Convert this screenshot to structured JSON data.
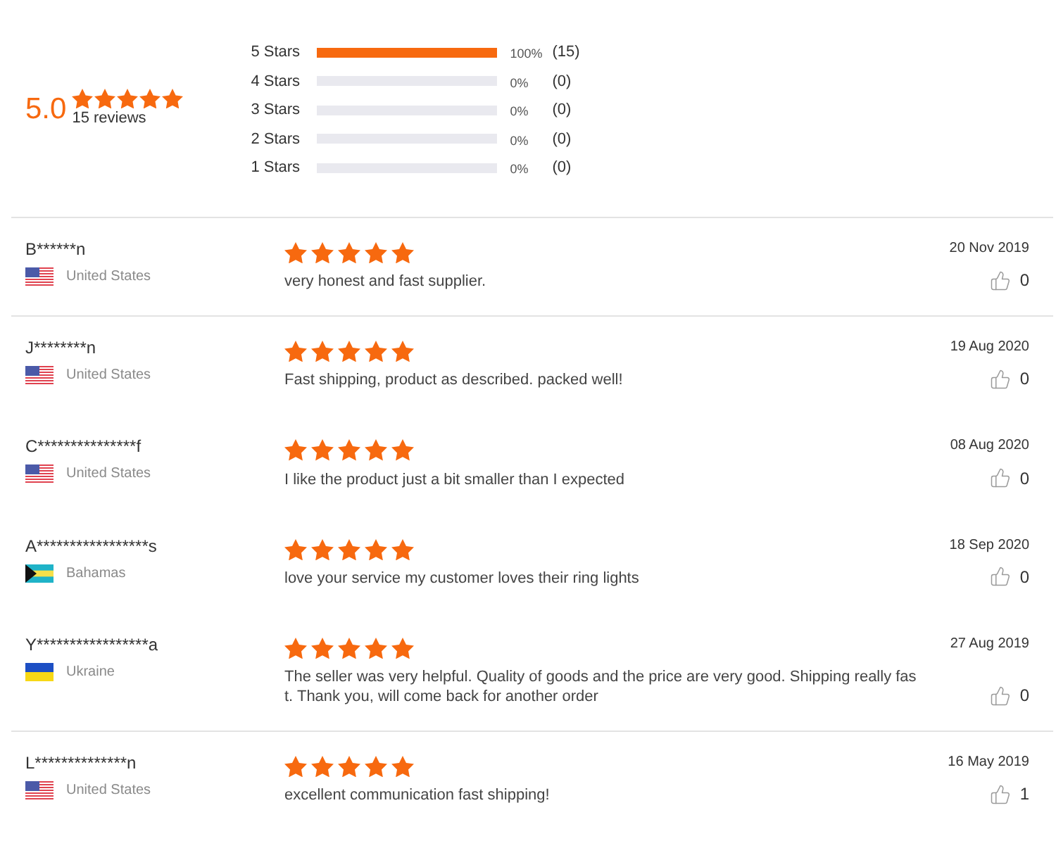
{
  "summary": {
    "rating": "5.0",
    "stars": 5,
    "review_count": "15 reviews"
  },
  "histogram": [
    {
      "label": "5 Stars",
      "level": 1,
      "percent": "100%",
      "count": "(15)"
    },
    {
      "label": "4 Stars",
      "level": 0,
      "percent": "0%",
      "count": "(0)"
    },
    {
      "label": "3 Stars",
      "level": 0,
      "percent": "0%",
      "count": "(0)"
    },
    {
      "label": "2 Stars",
      "level": 0,
      "percent": "0%",
      "count": "(0)"
    },
    {
      "label": "1 Stars",
      "level": 0,
      "percent": "0%",
      "count": "(0)"
    }
  ],
  "reviews": [
    {
      "name": "B******n",
      "flag": {
        "kind": "us"
      },
      "country": "United States",
      "stars": 5,
      "text": "very honest and fast supplier.",
      "date": "20 Nov 2019",
      "likes": "0",
      "divider_above": true
    },
    {
      "name": "J********n",
      "flag": {
        "kind": "us"
      },
      "country": "United States",
      "stars": 5,
      "text": "Fast shipping, product as described. packed well!",
      "date": "19 Aug 2020",
      "likes": "0",
      "divider_above": true
    },
    {
      "name": "C***************f",
      "flag": {
        "kind": "us"
      },
      "country": "United States",
      "stars": 5,
      "text": "I like the product just a bit smaller than I expected",
      "date": "08 Aug 2020",
      "likes": "0",
      "divider_above": false
    },
    {
      "name": "A*****************s",
      "flag": {
        "kind": "bs"
      },
      "country": "Bahamas",
      "stars": 5,
      "text": "love your service my customer loves their ring lights",
      "date": "18 Sep 2020",
      "likes": "0",
      "divider_above": false
    },
    {
      "name": "Y*****************a",
      "flag": {
        "kind": "ua"
      },
      "country": "Ukraine",
      "stars": 5,
      "text": "The seller was very helpful. Quality of goods and the price are very good. Shipping really fast. Thank you, will come back for another order",
      "date": "27 Aug 2019",
      "likes": "0",
      "divider_above": false
    },
    {
      "name": "L**************n",
      "flag": {
        "kind": "us"
      },
      "country": "United States",
      "stars": 5,
      "text": "excellent communication fast shipping!",
      "date": "16 May 2019",
      "likes": "1",
      "divider_above": true
    }
  ]
}
